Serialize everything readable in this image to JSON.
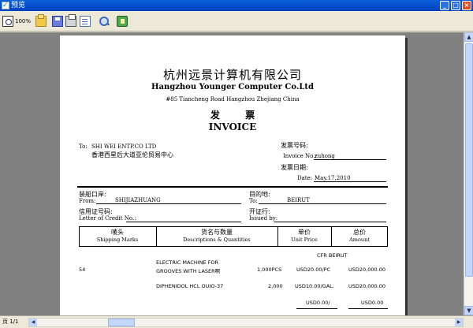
{
  "window": {
    "title": "预览"
  },
  "toolbar": {
    "zoom_label": "100%"
  },
  "invoice": {
    "company_cn": "杭州远景计算机有限公司",
    "company_en": "Hangzhou Younger Computer Co.Ltd",
    "address": "#85 Tiancheng Road Hangzhou Zhejiang China",
    "title_cn": "发  票",
    "title_en": "INVOICE",
    "to_label": "To:",
    "to_name": "SHI WEI ENTP.CO LTD",
    "to_name_cn": "香港西星后大道亚伦贸易中心",
    "invoice_no_cn": "发票号码:",
    "invoice_no_label": "Invoice No.:",
    "invoice_no": "zuhong",
    "date_cn": "发票日期:",
    "date_label": "Date:",
    "date": "May.17,2010",
    "port_cn": "装船口岸:",
    "from_label": "From:",
    "from_value": "SHIJIAZHUANG",
    "dest_cn": "目的地:",
    "to2_label": "To:",
    "to2_value": "BEIRUT",
    "credit_cn": "信用证号码:",
    "credit_label": "Letter of Credit No.:",
    "license_cn": "开证行:",
    "issued_label": "Issued by:",
    "headers": {
      "marks_cn": "唛头",
      "marks_en": "Shipping Marks",
      "desc_cn": "货名与数量",
      "desc_en": "Descriptions & Quantities",
      "price_cn": "单价",
      "price_en": "Unit Price",
      "amount_cn": "总价",
      "amount_en": "Amount"
    },
    "terms": "CFR BEIRUT",
    "mark": "54",
    "rows": [
      {
        "desc_line1": "ELECTRIC MACHINE FOR",
        "desc_line2": "GROOVES WITH LASER啊",
        "qty": "1,000PCS",
        "price": "USD20.00/PC",
        "amount": "USD20,000.00"
      },
      {
        "desc_line1": "DIPHENIDOL HCL OUIO-37",
        "desc_line2": "",
        "qty": "2,000",
        "price": "USD10.00/GAL.",
        "amount": "USD20,000.00"
      }
    ],
    "subtotal_price": "USD0.00/",
    "subtotal_amount": "USD0.00"
  },
  "status": {
    "page": "页 1/1"
  }
}
